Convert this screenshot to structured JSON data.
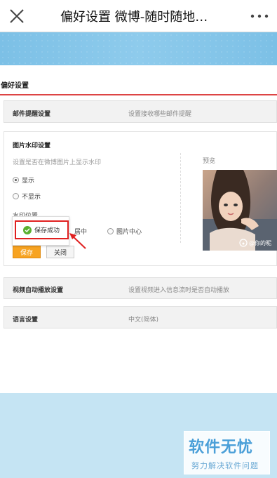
{
  "topbar": {
    "title": "偏好设置 微博-随时随地…",
    "close_icon": "close-icon",
    "more_icon": "more-dots-icon"
  },
  "panel": {
    "section_title": "偏好设置",
    "email_reminder": {
      "label": "邮件提醒设置",
      "desc": "设置接收哪些邮件提醒"
    },
    "watermark": {
      "title": "图片水印设置",
      "desc": "设置是否在微博图片上显示水印",
      "show_label": "显示",
      "hide_label": "不显示",
      "position_label": "水印位置",
      "center_label": "居中",
      "image_center_label": "图片中心",
      "preview_label": "预览",
      "preview_watermark_text": "@你的昵",
      "save_label": "保存",
      "close_label": "关闭"
    },
    "toast": {
      "text": "保存成功"
    },
    "video_autoplay": {
      "label": "视频自动播放设置",
      "desc": "设置视频进入信息流时是否自动播放"
    },
    "language": {
      "label": "语言设置",
      "value": "中文(简体)"
    }
  },
  "logo": {
    "main": "软件无忧",
    "sub": "努力解决软件问题"
  },
  "colors": {
    "accent_red": "#e02020",
    "save_orange": "#f7a321",
    "success_green": "#5bb030",
    "banner_blue": "#7cc0e6"
  }
}
